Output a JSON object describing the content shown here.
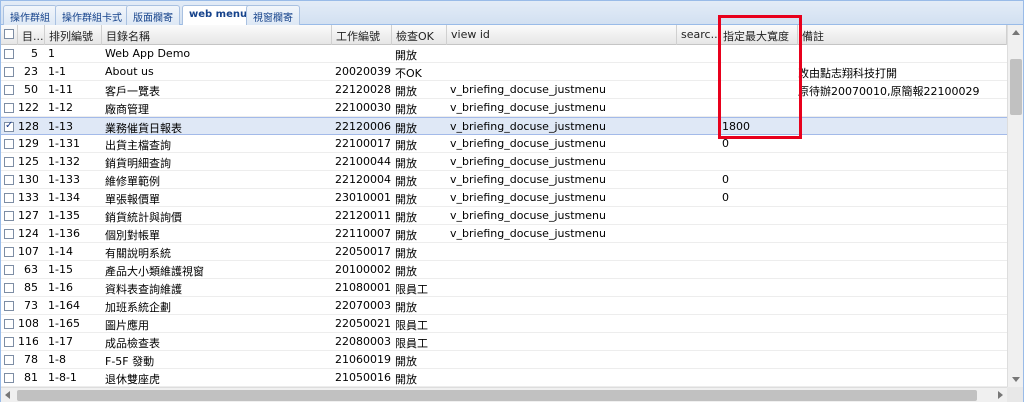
{
  "tabs": [
    {
      "label": "操作群組"
    },
    {
      "label": "操作群組卡式"
    },
    {
      "label": "版面欄寄"
    },
    {
      "label": "web menu"
    },
    {
      "label": "視窗欄寄"
    }
  ],
  "active_tab_index": 3,
  "columns": [
    {
      "label": "目..."
    },
    {
      "label": "排列編號"
    },
    {
      "label": "目錄名稱"
    },
    {
      "label": "工作編號"
    },
    {
      "label": "檢查OK"
    },
    {
      "label": "view id"
    },
    {
      "label": "searc..."
    },
    {
      "label": "指定最大寬度"
    },
    {
      "label": "備註"
    }
  ],
  "rows": [
    {
      "id": "5",
      "seq": "1",
      "name": "Web App Demo",
      "job": "",
      "check": "開放",
      "view": "",
      "search": "",
      "width": "",
      "note": "",
      "checked": false
    },
    {
      "id": "23",
      "seq": "1-1",
      "name": "About us",
      "job": "20020039",
      "check": "不OK",
      "view": "",
      "search": "",
      "width": "",
      "note": "改由點志翔科技打開",
      "checked": false
    },
    {
      "id": "50",
      "seq": "1-11",
      "name": "客戶一覽表",
      "job": "22120028",
      "check": "開放",
      "view": "v_briefing_docuse_justmenu",
      "search": "",
      "width": "",
      "note": "原待辦20070010,原簡報22100029",
      "checked": false
    },
    {
      "id": "122",
      "seq": "1-12",
      "name": "廠商管理",
      "job": "22100030",
      "check": "開放",
      "view": "v_briefing_docuse_justmenu",
      "search": "",
      "width": "",
      "note": "",
      "checked": false
    },
    {
      "id": "128",
      "seq": "1-13",
      "name": "業務催貨日報表",
      "job": "22120006",
      "check": "開放",
      "view": "v_briefing_docuse_justmenu",
      "search": "",
      "width": "1800",
      "note": "",
      "checked": true
    },
    {
      "id": "129",
      "seq": "1-131",
      "name": "出貨主檔查詢",
      "job": "22100017",
      "check": "開放",
      "view": "v_briefing_docuse_justmenu",
      "search": "",
      "width": "0",
      "note": "",
      "checked": false
    },
    {
      "id": "125",
      "seq": "1-132",
      "name": "銷貨明細查詢",
      "job": "22100044",
      "check": "開放",
      "view": "v_briefing_docuse_justmenu",
      "search": "",
      "width": "",
      "note": "",
      "checked": false
    },
    {
      "id": "130",
      "seq": "1-133",
      "name": "維修單範例",
      "job": "22120004",
      "check": "開放",
      "view": "v_briefing_docuse_justmenu",
      "search": "",
      "width": "0",
      "note": "",
      "checked": false
    },
    {
      "id": "133",
      "seq": "1-134",
      "name": "單張報價單",
      "job": "23010001",
      "check": "開放",
      "view": "v_briefing_docuse_justmenu",
      "search": "",
      "width": "0",
      "note": "",
      "checked": false
    },
    {
      "id": "127",
      "seq": "1-135",
      "name": "銷貨統計與詢價",
      "job": "22120011",
      "check": "開放",
      "view": "v_briefing_docuse_justmenu",
      "search": "",
      "width": "",
      "note": "",
      "checked": false
    },
    {
      "id": "124",
      "seq": "1-136",
      "name": "個別對帳單",
      "job": "22110007",
      "check": "開放",
      "view": "v_briefing_docuse_justmenu",
      "search": "",
      "width": "",
      "note": "",
      "checked": false
    },
    {
      "id": "107",
      "seq": "1-14",
      "name": "有關說明系統",
      "job": "22050017",
      "check": "開放",
      "view": "",
      "search": "",
      "width": "",
      "note": "",
      "checked": false
    },
    {
      "id": "63",
      "seq": "1-15",
      "name": "產品大小類維護視窗",
      "job": "20100002",
      "check": "開放",
      "view": "",
      "search": "",
      "width": "",
      "note": "",
      "checked": false
    },
    {
      "id": "85",
      "seq": "1-16",
      "name": "資料表查詢維護",
      "job": "21080001",
      "check": "限員工",
      "view": "",
      "search": "",
      "width": "",
      "note": "",
      "checked": false
    },
    {
      "id": "73",
      "seq": "1-164",
      "name": "加班系統企劃",
      "job": "22070003",
      "check": "開放",
      "view": "",
      "search": "",
      "width": "",
      "note": "",
      "checked": false
    },
    {
      "id": "108",
      "seq": "1-165",
      "name": "圖片應用",
      "job": "22050021",
      "check": "限員工",
      "view": "",
      "search": "",
      "width": "",
      "note": "",
      "checked": false
    },
    {
      "id": "116",
      "seq": "1-17",
      "name": "成品檢查表",
      "job": "22080003",
      "check": "限員工",
      "view": "",
      "search": "",
      "width": "",
      "note": "",
      "checked": false
    },
    {
      "id": "78",
      "seq": "1-8",
      "name": "F-5F 發動",
      "job": "21060019",
      "check": "開放",
      "view": "",
      "search": "",
      "width": "",
      "note": "",
      "checked": false
    },
    {
      "id": "81",
      "seq": "1-8-1",
      "name": "退休雙座虎",
      "job": "21050016",
      "check": "開放",
      "view": "",
      "search": "",
      "width": "",
      "note": "",
      "checked": false
    }
  ],
  "colors": {
    "selected_row": "#dfe8f6",
    "highlight_box": "#e8001c",
    "tab_text": "#15428b"
  }
}
